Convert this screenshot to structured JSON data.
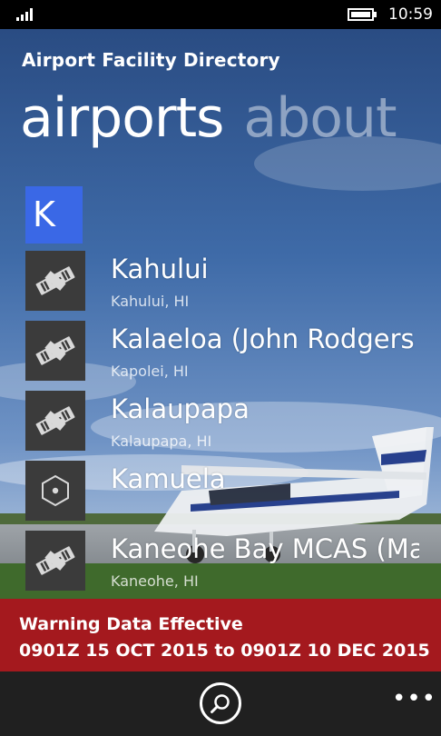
{
  "status_bar": {
    "time": "10:59",
    "signal_icon": "signal-bars-icon",
    "battery_icon": "battery-icon"
  },
  "header": {
    "app_title": "Airport Facility Directory",
    "tabs": [
      {
        "label": "airports",
        "active": true
      },
      {
        "label": "about",
        "active": false
      }
    ]
  },
  "group": {
    "letter": "K",
    "accent_color": "#3a68e6"
  },
  "airports": [
    {
      "name": "Kahului",
      "location": "Kahului, HI",
      "icon": "runway-icon"
    },
    {
      "name": "Kalaeloa (John Rodgers Fld)",
      "location": "Kapolei, HI",
      "icon": "runway-icon"
    },
    {
      "name": "Kalaupapa",
      "location": "Kalaupapa, HI",
      "icon": "runway-icon"
    },
    {
      "name": "Kamuela",
      "location": "",
      "icon": "heliport-icon"
    },
    {
      "name": "Kaneohe Bay MCAS (Marion E Carl Fld)",
      "location": "Kaneohe, HI",
      "icon": "runway-icon"
    }
  ],
  "warning": {
    "line1": "Warning Data Effective",
    "line2": "0901Z 15 OCT 2015 to 0901Z 10 DEC 2015",
    "color": "#a4191e"
  },
  "app_bar": {
    "search_icon": "search-icon",
    "more_label": "•••"
  }
}
